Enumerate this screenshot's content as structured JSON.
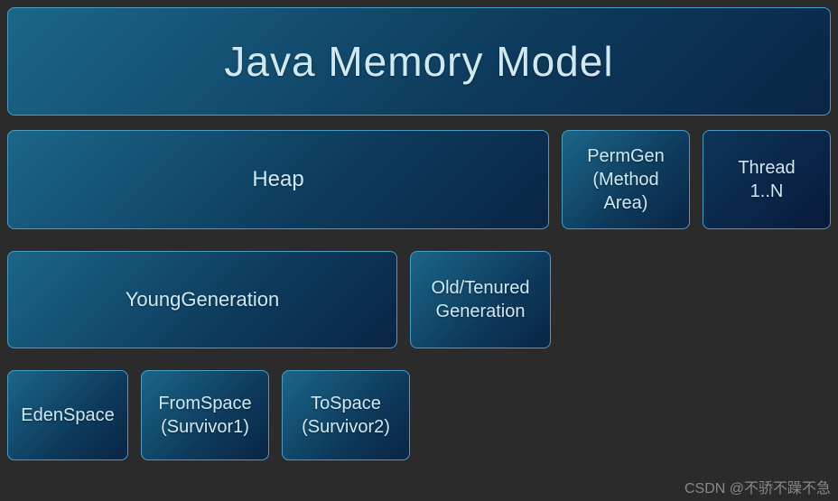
{
  "title": "Java Memory Model",
  "row2": {
    "heap": "Heap",
    "permgen": "PermGen\n(Method\nArea)",
    "thread": "Thread\n1..N"
  },
  "row3": {
    "young": "YoungGeneration",
    "old": "Old/Tenured\nGeneration"
  },
  "row4": {
    "eden": "EdenSpace",
    "from": "FromSpace\n(Survivor1)",
    "to": "ToSpace\n(Survivor2)"
  },
  "watermark": "CSDN @不骄不躁不急"
}
